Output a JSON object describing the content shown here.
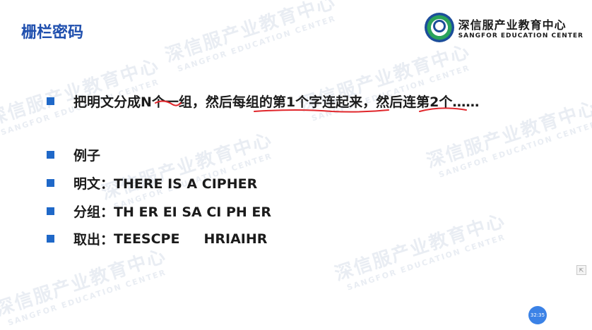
{
  "slide": {
    "title": "栅栏密码",
    "bullets": [
      {
        "text": "把明文分成N个一组，然后每组的第1个字连起来，然后连第2个……"
      },
      {
        "text": "例子"
      },
      {
        "text": "明文：THERE IS A CIPHER"
      },
      {
        "text": "分组：TH ER EI SA CI PH ER"
      },
      {
        "label": "取出：",
        "part1": "TEESCPE",
        "part2": "HRIAIHR"
      }
    ]
  },
  "logo": {
    "name_cn": "深信服产业教育中心",
    "name_en": "SANGFOR EDUCATION CENTER"
  },
  "watermark": {
    "text_cn": "深信服产业教育中心",
    "text_en": "SANGFOR EDUCATION CENTER"
  },
  "player": {
    "timer": "32:35",
    "side_icon": "expand-icon"
  },
  "colors": {
    "title": "#1f4fae",
    "bullet_square": "#1f68c8",
    "underline": "#e0262b",
    "timer_bg": "#3b82e6"
  }
}
